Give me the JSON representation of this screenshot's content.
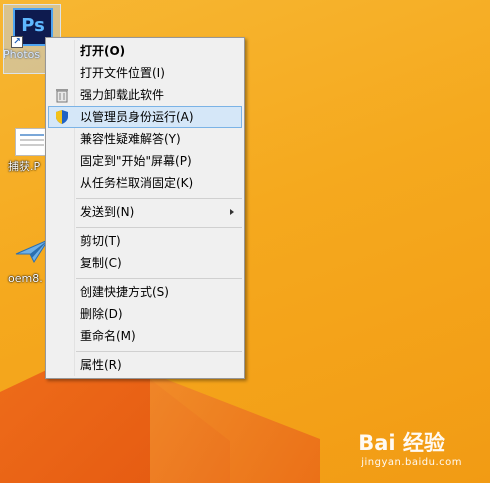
{
  "desktop": {
    "icons": [
      {
        "label": "Photos",
        "glyph": "Ps",
        "icon": "photoshop-icon"
      },
      {
        "label": "捕获.P",
        "icon": "document-thumbnail-icon"
      },
      {
        "label": "oem8.",
        "icon": "paper-plane-icon"
      }
    ]
  },
  "menu": {
    "items": [
      {
        "label": "打开(O)",
        "bold": true
      },
      {
        "label": "打开文件位置(I)"
      },
      {
        "label": "强力卸载此软件",
        "icon": "trash-icon"
      },
      {
        "label": "以管理员身份运行(A)",
        "icon": "uac-shield-icon",
        "highlighted": true
      },
      {
        "label": "兼容性疑难解答(Y)"
      },
      {
        "label": "固定到\"开始\"屏幕(P)"
      },
      {
        "label": "从任务栏取消固定(K)"
      },
      {
        "label": "发送到(N)",
        "submenu": true
      },
      {
        "label": "剪切(T)"
      },
      {
        "label": "复制(C)"
      },
      {
        "label": "创建快捷方式(S)"
      },
      {
        "label": "删除(D)"
      },
      {
        "label": "重命名(M)"
      },
      {
        "label": "属性(R)"
      }
    ]
  },
  "watermark": {
    "main": "Bai 经验",
    "sub": "jingyan.baidu.com"
  },
  "colors": {
    "highlight": "#d5e7f8",
    "highlight_border": "#7bb3e6",
    "menu_bg": "#f0f0f0"
  }
}
